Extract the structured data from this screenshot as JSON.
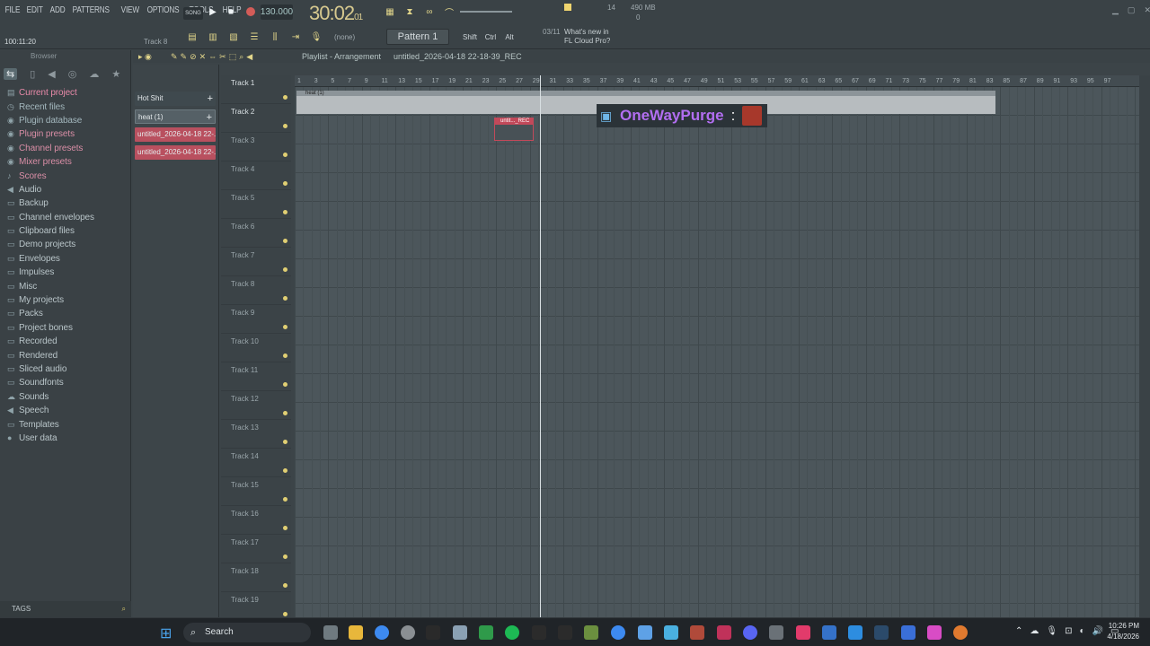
{
  "menu": [
    "FILE",
    "EDIT",
    "ADD",
    "PATTERNS",
    "VIEW",
    "OPTIONS",
    "TOOLS",
    "HELP"
  ],
  "transport": {
    "song_label": "SONG",
    "tempo": "130.000",
    "time": "30:02",
    "time_ms": "01",
    "time_unit": "B:S:T",
    "cpu": "14",
    "memory": "490 MB",
    "voices": "0"
  },
  "hint": {
    "position": "100:11:20",
    "track": "Track 8"
  },
  "pattern": {
    "snap": "(none)",
    "name": "Pattern 1",
    "shift": "Shift",
    "ctrl": "Ctrl",
    "alt": "Alt",
    "news_counter": "03/11",
    "news_text": "What's new in FL Cloud Pro?"
  },
  "browser": {
    "title": "Browser",
    "tags": "TAGS",
    "items": [
      "Current project",
      "Recent files",
      "Plugin database",
      "Plugin presets",
      "Channel presets",
      "Mixer presets",
      "Scores",
      "Audio",
      "Backup",
      "Channel envelopes",
      "Clipboard files",
      "Demo projects",
      "Envelopes",
      "Impulses",
      "Misc",
      "My projects",
      "Packs",
      "Project bones",
      "Recorded",
      "Rendered",
      "Sliced audio",
      "Soundfonts",
      "Sounds",
      "Speech",
      "Templates",
      "User data"
    ]
  },
  "patterns": [
    "Hot Shit",
    "heat (1)",
    "untitled_2026-04-18 22-...",
    "untitled_2026-04-18 22-..."
  ],
  "playlist": {
    "title": "Playlist - Arrangement",
    "project": "untitled_2026-04-18 22-18-39_REC",
    "tracks": [
      "Track 1",
      "Track 2",
      "Track 3",
      "Track 4",
      "Track 5",
      "Track 6",
      "Track 7",
      "Track 8",
      "Track 9",
      "Track 10",
      "Track 11",
      "Track 12",
      "Track 13",
      "Track 14",
      "Track 15",
      "Track 16",
      "Track 17",
      "Track 18",
      "Track 19"
    ],
    "ruler": [
      "1",
      "3",
      "5",
      "7",
      "9",
      "11",
      "13",
      "15",
      "17",
      "19",
      "21",
      "23",
      "25",
      "27",
      "29",
      "31",
      "33",
      "35",
      "37",
      "39",
      "41",
      "43",
      "45",
      "47",
      "49",
      "51",
      "53",
      "55",
      "57",
      "59",
      "61",
      "63",
      "65",
      "67",
      "69",
      "71",
      "73",
      "75",
      "77",
      "79",
      "81",
      "83",
      "85",
      "87",
      "89",
      "91",
      "93",
      "95",
      "97"
    ],
    "clip1": "heat (1)",
    "clip2": "untit..._REC"
  },
  "overlay": {
    "name": "OneWayPurge",
    "sep": ":"
  },
  "taskbar": {
    "search": "Search",
    "time": "10:26 PM",
    "date": "4/18/2026"
  }
}
